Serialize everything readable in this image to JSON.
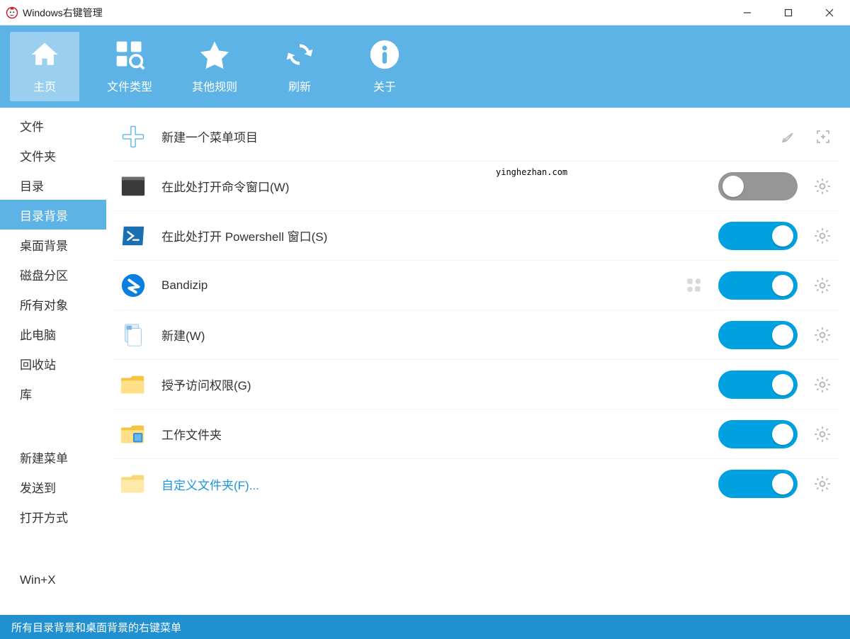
{
  "window": {
    "title": "Windows右键管理"
  },
  "toolbar": [
    {
      "key": "home",
      "label": "主页",
      "selected": true
    },
    {
      "key": "filetype",
      "label": "文件类型",
      "selected": false
    },
    {
      "key": "rules",
      "label": "其他规则",
      "selected": false
    },
    {
      "key": "refresh",
      "label": "刷新",
      "selected": false
    },
    {
      "key": "about",
      "label": "关于",
      "selected": false
    }
  ],
  "sidebar": {
    "primary": [
      {
        "key": "file",
        "label": "文件"
      },
      {
        "key": "folder",
        "label": "文件夹"
      },
      {
        "key": "directory",
        "label": "目录"
      },
      {
        "key": "dir-bg",
        "label": "目录背景",
        "selected": true
      },
      {
        "key": "desktop-bg",
        "label": "桌面背景"
      },
      {
        "key": "disk",
        "label": "磁盘分区"
      },
      {
        "key": "all-obj",
        "label": "所有对象"
      },
      {
        "key": "this-pc",
        "label": "此电脑"
      },
      {
        "key": "recycle",
        "label": "回收站"
      },
      {
        "key": "library",
        "label": "库"
      }
    ],
    "secondary": [
      {
        "key": "new-menu",
        "label": "新建菜单"
      },
      {
        "key": "send-to",
        "label": "发送到"
      },
      {
        "key": "open-with",
        "label": "打开方式"
      }
    ],
    "tertiary": [
      {
        "key": "winx",
        "label": "Win+X"
      }
    ]
  },
  "main": {
    "rows": [
      {
        "key": "add",
        "icon": "plus",
        "label": "新建一个菜单项目",
        "toggle": null,
        "gear": false,
        "extras": [
          "rocket",
          "focus"
        ],
        "link": false
      },
      {
        "key": "cmd",
        "icon": "cmd",
        "label": "在此处打开命令窗口(W)",
        "toggle": false,
        "gear": true,
        "extras": [],
        "link": false
      },
      {
        "key": "powershell",
        "icon": "powershell",
        "label": "在此处打开 Powershell 窗口(S)",
        "toggle": true,
        "gear": true,
        "extras": [],
        "link": false
      },
      {
        "key": "bandizip",
        "icon": "bandizip",
        "label": "Bandizip",
        "toggle": true,
        "gear": true,
        "extras": [
          "shapes"
        ],
        "link": false
      },
      {
        "key": "new",
        "icon": "doc",
        "label": "新建(W)",
        "toggle": true,
        "gear": true,
        "extras": [],
        "link": false
      },
      {
        "key": "grant",
        "icon": "folder-y",
        "label": "授予访问权限(G)",
        "toggle": true,
        "gear": true,
        "extras": [],
        "link": false
      },
      {
        "key": "workfolder",
        "icon": "folder-b",
        "label": "工作文件夹",
        "toggle": true,
        "gear": true,
        "extras": [],
        "link": false
      },
      {
        "key": "custom",
        "icon": "folder-p",
        "label": "自定义文件夹(F)...",
        "toggle": true,
        "gear": true,
        "extras": [],
        "link": true
      }
    ]
  },
  "statusbar": {
    "text": "所有目录背景和桌面背景的右键菜单"
  },
  "watermark": "yinghezhan.com",
  "colors": {
    "accent": "#5db3e6",
    "toggleOn": "#00a1e1",
    "toggleOff": "#969696",
    "status": "#2190d0"
  }
}
